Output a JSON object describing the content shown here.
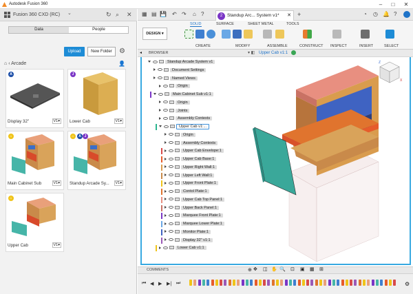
{
  "window": {
    "title": "Autodesk Fusion 360"
  },
  "left_panel": {
    "project": "Fusion 360 CXD (RC)",
    "tabs": [
      "Data",
      "People"
    ],
    "upload_label": "Upload",
    "new_folder_label": "New Folder",
    "breadcrumb": "Arcade",
    "items": [
      {
        "name": "Display 32\"",
        "version": "V1"
      },
      {
        "name": "Lower Cab",
        "version": "V1"
      },
      {
        "name": "Main Cabinet Sub",
        "version": "V1"
      },
      {
        "name": "Standup Arcade Sy...",
        "version": "V1"
      },
      {
        "name": "Upper Cab",
        "version": "V1"
      }
    ]
  },
  "document_tab": {
    "number": "2",
    "title": "Standup Arc... System v1*"
  },
  "ribbon": {
    "workspace": "DESIGN",
    "tabs": [
      "SOLID",
      "SURFACE",
      "SHEET METAL",
      "TOOLS"
    ],
    "groups": [
      "CREATE",
      "MODIFY",
      "ASSEMBLE",
      "CONSTRUCT",
      "INSPECT",
      "INSERT",
      "SELECT"
    ]
  },
  "browser": {
    "header": "BROWSER",
    "active_component": "Upper Cab v1:1",
    "tree": [
      {
        "label": "Standup Arcade System v1",
        "level": 0
      },
      {
        "label": "Document Settings",
        "level": 1
      },
      {
        "label": "Named Views",
        "level": 1
      },
      {
        "label": "Origin",
        "level": 2
      },
      {
        "label": "Main Cabinet Sub v1:1",
        "level": 1
      },
      {
        "label": "Origin",
        "level": 2
      },
      {
        "label": "Joints",
        "level": 2
      },
      {
        "label": "Assembly Contexts",
        "level": 2
      },
      {
        "label": "Upper Cab v1:...",
        "level": 2
      },
      {
        "label": "Origin",
        "level": 3
      },
      {
        "label": "Assembly Contexts",
        "level": 3
      },
      {
        "label": "Upper Cab Envelope:1",
        "level": 3
      },
      {
        "label": "Upper Cab Base:1",
        "level": 3
      },
      {
        "label": "Upper Right Wall:1",
        "level": 3
      },
      {
        "label": "Upper Left Wall:1",
        "level": 3
      },
      {
        "label": "Upper Front Plate:1",
        "level": 3
      },
      {
        "label": "Contol Plate:1",
        "level": 3
      },
      {
        "label": "Upper Cab Top Panel:1",
        "level": 3
      },
      {
        "label": "Upper Back Panel:1",
        "level": 3
      },
      {
        "label": "Marquee Front Plate:1",
        "level": 3
      },
      {
        "label": "Marquee Lower Plate:1",
        "level": 3
      },
      {
        "label": "Monitor Plate:1",
        "level": 3
      },
      {
        "label": "Display 32\" v1:1",
        "level": 3
      },
      {
        "label": "Lower Cab v1:1",
        "level": 2
      }
    ]
  },
  "comments_label": "COMMENTS",
  "colors": {
    "accent": "#1e8cd6",
    "viewport_border": "#37a9e1",
    "badge_purple": "#7a35c6",
    "badge_yellow": "#f0c419"
  }
}
